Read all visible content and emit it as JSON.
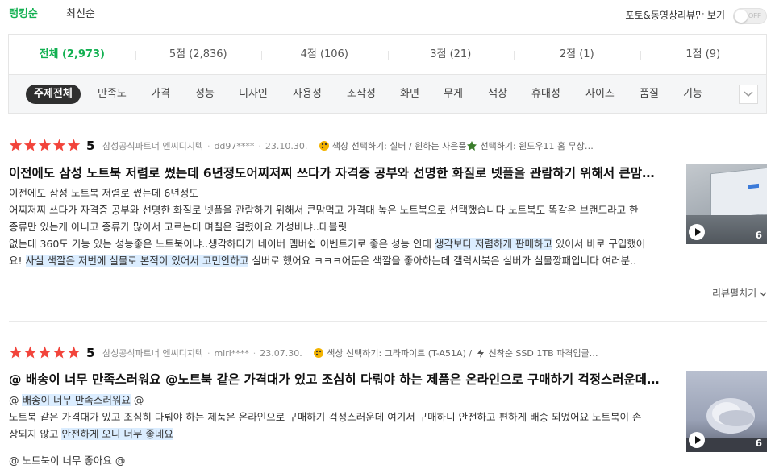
{
  "sort": {
    "ranking": "랭킹순",
    "latest": "최신순",
    "media_only": "포토&동영상리뷰만 보기",
    "toggle_text": "OFF"
  },
  "score_tabs": [
    "전체 (2,973)",
    "5점 (2,836)",
    "4점 (106)",
    "3점 (21)",
    "2점 (1)",
    "1점 (9)"
  ],
  "topics": [
    "주제전체",
    "만족도",
    "가격",
    "성능",
    "디자인",
    "사용성",
    "조작성",
    "화면",
    "무게",
    "색상",
    "휴대성",
    "사이즈",
    "품질",
    "기능"
  ],
  "colors": {
    "accent": "#12b051",
    "star": "#f2443b",
    "highlight": "#dbedff"
  },
  "reviews": [
    {
      "rating": 5,
      "seller": "삼성공식파트너 엔씨디지텍",
      "user": "dd97****",
      "date": "23.10.30.",
      "option": "색상 선택하기: 실버 / 원하는 사은품",
      "option2": "선택하기: 윈도우11 홈 무상…",
      "title": "이전에도 삼성 노트북 저렴로 썼는데 6년정도어찌저찌 쓰다가 자격증 공부와 선명한 화질로 넷플을 관람하기 위해서 큰맘…",
      "body_line1": "이전에도 삼성 노트북 저렴로 썼는데 6년정도",
      "body_line2": "어찌저찌 쓰다가 자격증 공부와 선명한 화질로 넷플을 관람하기 위해서 큰맘먹고 가격대 높은 노트북으로 선택했습니다 노트북도 똑같은 브랜드라고 한",
      "body_line3": "종류만 있는게 아니고 종류가 많아서 고르는데 며칠은 걸렸어요 가성비냐..태블릿",
      "body_line4a": "없는데 360도 기능 있는 성능좋은 노트북이냐..생각하다가 네이버 멤버쉽 이벤트가로 좋은 성능 인데 ",
      "body_line4b": "생각보다 저렴하게 판매하고",
      "body_line4c": " 있어서 바로 구입했어",
      "body_line5a": "요! ",
      "body_line5b": "사실 색깔은 저번에 실물로 본적이 있어서 고민안하고",
      "body_line5c": " 실버로 했어요 ㅋㅋㅋ어둔운 색깔을 좋아하는데 갤럭시북은 실버가 실물깡패입니다 여러분..",
      "media_count": "6",
      "expand": "리뷰펼치기"
    },
    {
      "rating": 5,
      "seller": "삼성공식파트너 엔씨디지텍",
      "user": "miri****",
      "date": "23.07.30.",
      "option": "색상 선택하기: 그라파이트 (T-A51A) /",
      "option2": "선착순 SSD 1TB 파격업글…",
      "title": "@ 배송이 너무 만족스러워요 @노트북 같은 가격대가 있고 조심히 다뤄야 하는 제품은 온라인으로 구매하기 걱정스러운데…",
      "body_line1a": "@ ",
      "body_line1b": "배송이 너무 만족스러워요",
      "body_line1c": " @",
      "body_line2": "노트북 같은 가격대가 있고 조심히 다뤄야 하는 제품은 온라인으로 구매하기 걱정스러운데 여기서 구매하니 안전하고 편하게 배송 되었어요 노트북이 손",
      "body_line3a": "상되지 않고 ",
      "body_line3b": "안전하게 오니 너무 좋네요",
      "body_line4": "@ 노트북이 너무 좋아요 @",
      "media_count": "6"
    }
  ]
}
